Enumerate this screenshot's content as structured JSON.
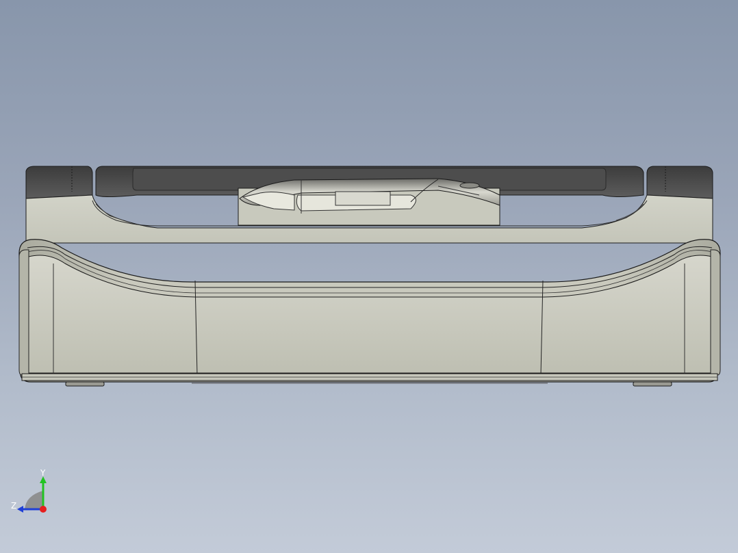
{
  "viewport": {
    "background_top": "#8896ab",
    "background_bottom": "#c3cbd8"
  },
  "model": {
    "body_color": "#c9c9bd",
    "dark_trim_color": "#4a4a4a",
    "edge_color": "#1a1a1a"
  },
  "triad": {
    "y_label": "Y",
    "z_label": "Z",
    "y_color": "#22c322",
    "z_color": "#1f3fd6",
    "x_color": "#e61e1e"
  }
}
